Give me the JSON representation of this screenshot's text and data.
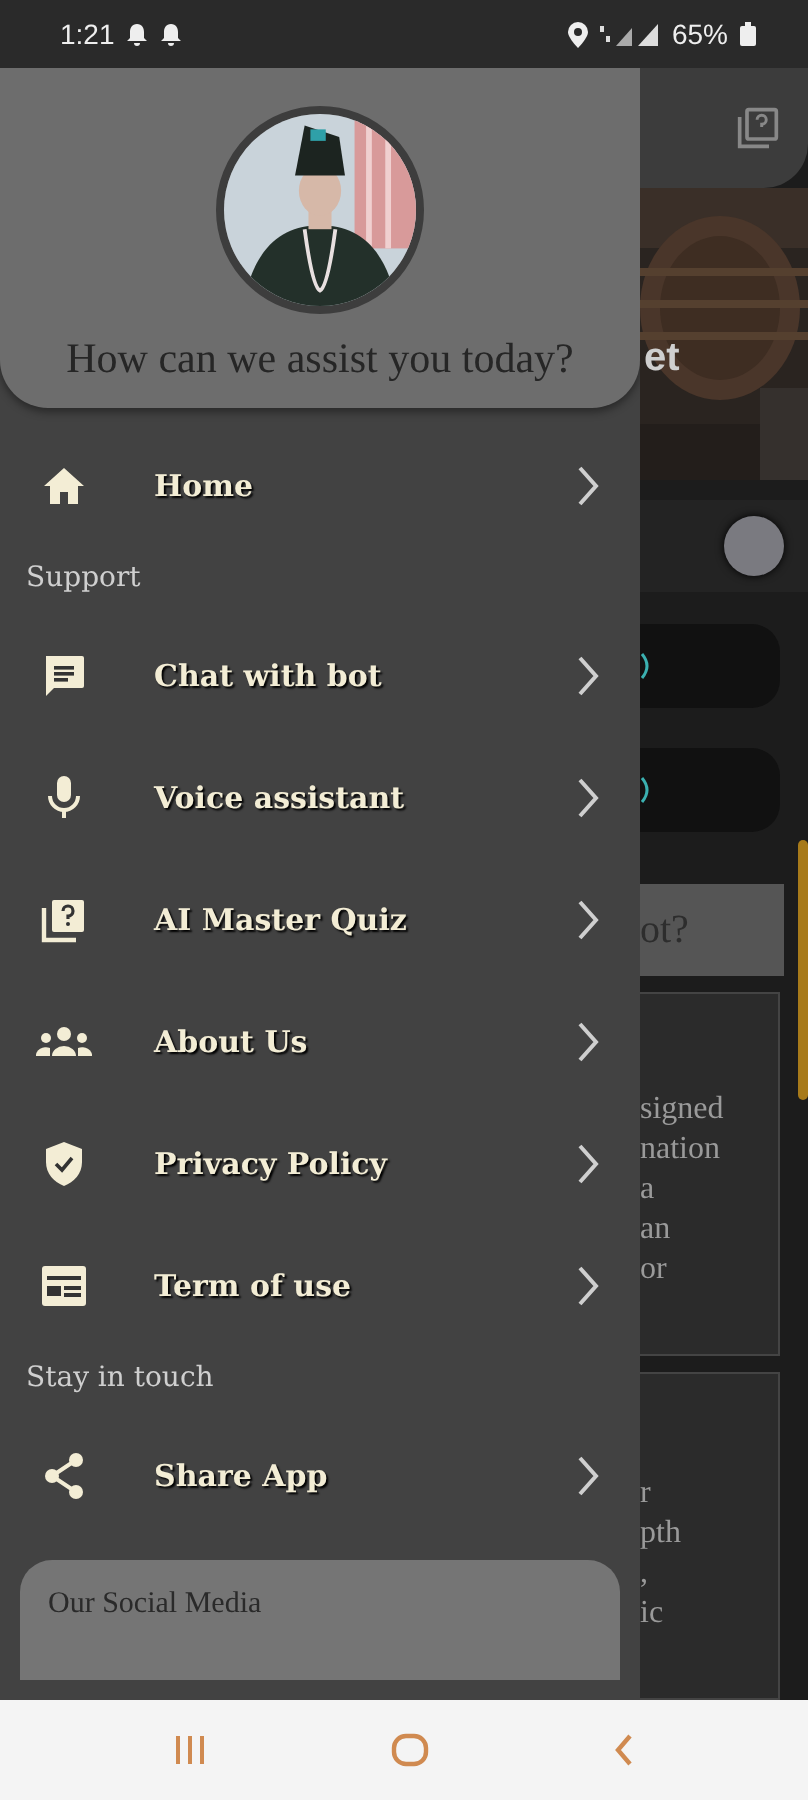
{
  "status_bar": {
    "time": "1:21",
    "battery": "65%"
  },
  "drawer": {
    "greeting": "How can we assist you today?",
    "entries": [
      {
        "kind": "item",
        "label": "Home"
      },
      {
        "kind": "heading",
        "label": "Support"
      },
      {
        "kind": "item",
        "label": "Chat with bot"
      },
      {
        "kind": "item",
        "label": "Voice assistant"
      },
      {
        "kind": "item",
        "label": "AI Master Quiz"
      },
      {
        "kind": "item",
        "label": "About Us"
      },
      {
        "kind": "item",
        "label": "Privacy Policy"
      },
      {
        "kind": "item",
        "label": "Term of use"
      },
      {
        "kind": "heading",
        "label": "Stay in touch"
      },
      {
        "kind": "item",
        "label": "Share App"
      }
    ],
    "social_title": "Our Social Media"
  },
  "background": {
    "title_fragment": "et",
    "question_fragment": "ot?",
    "card_1_lines": [
      "signed",
      "nation",
      "a",
      "an",
      "or"
    ],
    "card_2_lines": [
      "r",
      "pth",
      ",",
      "ic"
    ]
  }
}
